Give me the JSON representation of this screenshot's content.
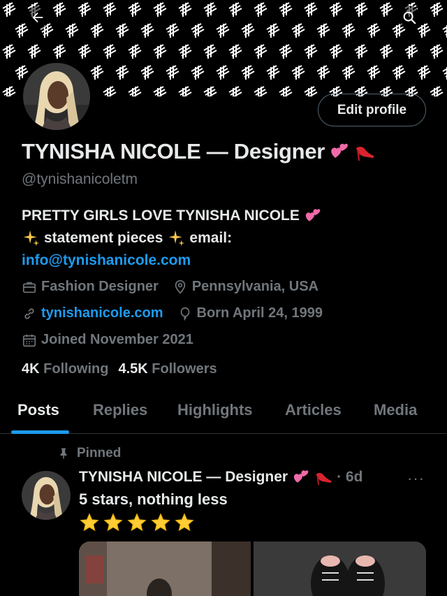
{
  "header": {
    "back_icon": "arrow-left-icon",
    "search_icon": "search-icon"
  },
  "profile": {
    "edit_label": "Edit profile",
    "display_name": "TYNISHA NICOLE — Designer",
    "name_emojis": [
      "two-hearts-emoji",
      "high-heel-emoji"
    ],
    "handle": "@tynishanicoletm",
    "bio_line1": "PRETTY GIRLS LOVE TYNISHA NICOLE",
    "bio_line2a": "statement pieces",
    "bio_line2b": "email:",
    "bio_email": "info@tynishanicole.com",
    "occupation": "Fashion Designer",
    "location": "Pennsylvania, USA",
    "website": "tynishanicole.com",
    "born": "Born April 24, 1999",
    "joined": "Joined November 2021",
    "following_count": "4K",
    "following_label": "Following",
    "followers_count": "4.5K",
    "followers_label": "Followers"
  },
  "tabs": [
    {
      "label": "Posts",
      "active": true
    },
    {
      "label": "Replies",
      "active": false
    },
    {
      "label": "Highlights",
      "active": false
    },
    {
      "label": "Articles",
      "active": false
    },
    {
      "label": "Media",
      "active": false
    }
  ],
  "post": {
    "pinned_label": "Pinned",
    "author": "TYNISHA NICOLE — Designer",
    "time": "· 6d",
    "more": "···",
    "text": "5 stars, nothing less",
    "stars": 5
  },
  "colors": {
    "accent": "#1d9bf0",
    "muted": "#71767b",
    "text": "#e7e9ea",
    "background": "#000000"
  }
}
